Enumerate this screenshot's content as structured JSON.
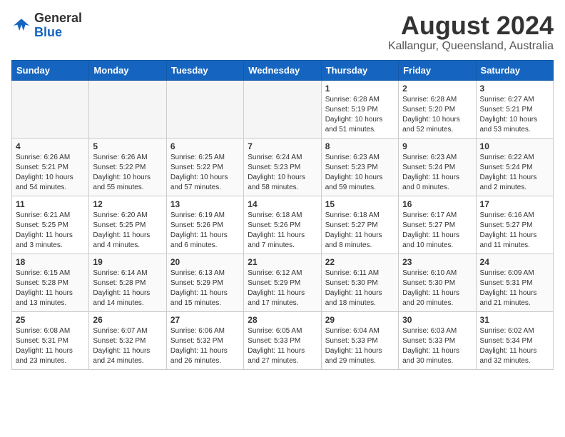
{
  "header": {
    "logo_general": "General",
    "logo_blue": "Blue",
    "month_year": "August 2024",
    "location": "Kallangur, Queensland, Australia"
  },
  "weekdays": [
    "Sunday",
    "Monday",
    "Tuesday",
    "Wednesday",
    "Thursday",
    "Friday",
    "Saturday"
  ],
  "weeks": [
    [
      {
        "day": "",
        "info": ""
      },
      {
        "day": "",
        "info": ""
      },
      {
        "day": "",
        "info": ""
      },
      {
        "day": "",
        "info": ""
      },
      {
        "day": "1",
        "info": "Sunrise: 6:28 AM\nSunset: 5:19 PM\nDaylight: 10 hours\nand 51 minutes."
      },
      {
        "day": "2",
        "info": "Sunrise: 6:28 AM\nSunset: 5:20 PM\nDaylight: 10 hours\nand 52 minutes."
      },
      {
        "day": "3",
        "info": "Sunrise: 6:27 AM\nSunset: 5:21 PM\nDaylight: 10 hours\nand 53 minutes."
      }
    ],
    [
      {
        "day": "4",
        "info": "Sunrise: 6:26 AM\nSunset: 5:21 PM\nDaylight: 10 hours\nand 54 minutes."
      },
      {
        "day": "5",
        "info": "Sunrise: 6:26 AM\nSunset: 5:22 PM\nDaylight: 10 hours\nand 55 minutes."
      },
      {
        "day": "6",
        "info": "Sunrise: 6:25 AM\nSunset: 5:22 PM\nDaylight: 10 hours\nand 57 minutes."
      },
      {
        "day": "7",
        "info": "Sunrise: 6:24 AM\nSunset: 5:23 PM\nDaylight: 10 hours\nand 58 minutes."
      },
      {
        "day": "8",
        "info": "Sunrise: 6:23 AM\nSunset: 5:23 PM\nDaylight: 10 hours\nand 59 minutes."
      },
      {
        "day": "9",
        "info": "Sunrise: 6:23 AM\nSunset: 5:24 PM\nDaylight: 11 hours\nand 0 minutes."
      },
      {
        "day": "10",
        "info": "Sunrise: 6:22 AM\nSunset: 5:24 PM\nDaylight: 11 hours\nand 2 minutes."
      }
    ],
    [
      {
        "day": "11",
        "info": "Sunrise: 6:21 AM\nSunset: 5:25 PM\nDaylight: 11 hours\nand 3 minutes."
      },
      {
        "day": "12",
        "info": "Sunrise: 6:20 AM\nSunset: 5:25 PM\nDaylight: 11 hours\nand 4 minutes."
      },
      {
        "day": "13",
        "info": "Sunrise: 6:19 AM\nSunset: 5:26 PM\nDaylight: 11 hours\nand 6 minutes."
      },
      {
        "day": "14",
        "info": "Sunrise: 6:18 AM\nSunset: 5:26 PM\nDaylight: 11 hours\nand 7 minutes."
      },
      {
        "day": "15",
        "info": "Sunrise: 6:18 AM\nSunset: 5:27 PM\nDaylight: 11 hours\nand 8 minutes."
      },
      {
        "day": "16",
        "info": "Sunrise: 6:17 AM\nSunset: 5:27 PM\nDaylight: 11 hours\nand 10 minutes."
      },
      {
        "day": "17",
        "info": "Sunrise: 6:16 AM\nSunset: 5:27 PM\nDaylight: 11 hours\nand 11 minutes."
      }
    ],
    [
      {
        "day": "18",
        "info": "Sunrise: 6:15 AM\nSunset: 5:28 PM\nDaylight: 11 hours\nand 13 minutes."
      },
      {
        "day": "19",
        "info": "Sunrise: 6:14 AM\nSunset: 5:28 PM\nDaylight: 11 hours\nand 14 minutes."
      },
      {
        "day": "20",
        "info": "Sunrise: 6:13 AM\nSunset: 5:29 PM\nDaylight: 11 hours\nand 15 minutes."
      },
      {
        "day": "21",
        "info": "Sunrise: 6:12 AM\nSunset: 5:29 PM\nDaylight: 11 hours\nand 17 minutes."
      },
      {
        "day": "22",
        "info": "Sunrise: 6:11 AM\nSunset: 5:30 PM\nDaylight: 11 hours\nand 18 minutes."
      },
      {
        "day": "23",
        "info": "Sunrise: 6:10 AM\nSunset: 5:30 PM\nDaylight: 11 hours\nand 20 minutes."
      },
      {
        "day": "24",
        "info": "Sunrise: 6:09 AM\nSunset: 5:31 PM\nDaylight: 11 hours\nand 21 minutes."
      }
    ],
    [
      {
        "day": "25",
        "info": "Sunrise: 6:08 AM\nSunset: 5:31 PM\nDaylight: 11 hours\nand 23 minutes."
      },
      {
        "day": "26",
        "info": "Sunrise: 6:07 AM\nSunset: 5:32 PM\nDaylight: 11 hours\nand 24 minutes."
      },
      {
        "day": "27",
        "info": "Sunrise: 6:06 AM\nSunset: 5:32 PM\nDaylight: 11 hours\nand 26 minutes."
      },
      {
        "day": "28",
        "info": "Sunrise: 6:05 AM\nSunset: 5:33 PM\nDaylight: 11 hours\nand 27 minutes."
      },
      {
        "day": "29",
        "info": "Sunrise: 6:04 AM\nSunset: 5:33 PM\nDaylight: 11 hours\nand 29 minutes."
      },
      {
        "day": "30",
        "info": "Sunrise: 6:03 AM\nSunset: 5:33 PM\nDaylight: 11 hours\nand 30 minutes."
      },
      {
        "day": "31",
        "info": "Sunrise: 6:02 AM\nSunset: 5:34 PM\nDaylight: 11 hours\nand 32 minutes."
      }
    ]
  ]
}
